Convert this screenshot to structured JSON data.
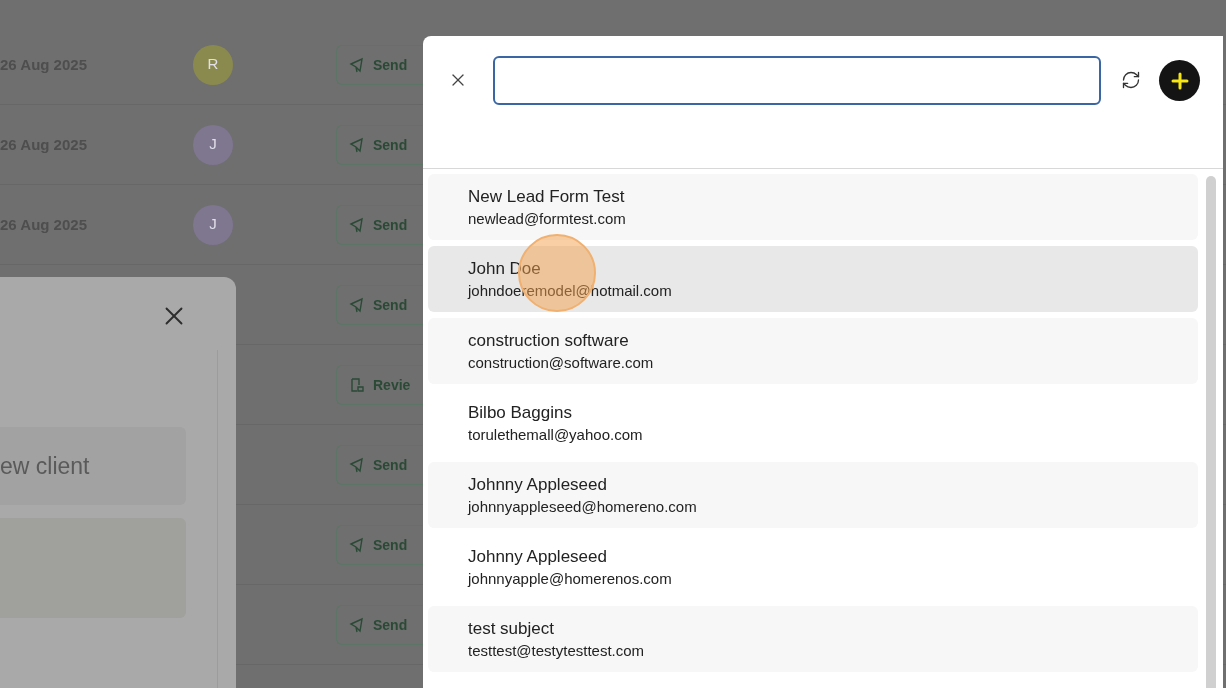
{
  "background_rows": [
    {
      "date": "26 Aug 2025",
      "avatar": {
        "letter": "R",
        "color": "#8b8a4e"
      },
      "action": {
        "kind": "send",
        "label": "Send"
      }
    },
    {
      "date": "26 Aug 2025",
      "avatar": {
        "letter": "J",
        "color": "#7f7690"
      },
      "action": {
        "kind": "send",
        "label": "Send"
      }
    },
    {
      "date": "26 Aug 2025",
      "avatar": {
        "letter": "J",
        "color": "#7f7690"
      },
      "action": {
        "kind": "send",
        "label": "Send"
      }
    },
    {
      "action": {
        "kind": "send",
        "label": "Send"
      }
    },
    {
      "action": {
        "kind": "review",
        "label": "Revie"
      }
    },
    {
      "action": {
        "kind": "send",
        "label": "Send"
      }
    },
    {
      "action": {
        "kind": "send",
        "label": "Send"
      }
    },
    {
      "action": {
        "kind": "send",
        "label": "Send"
      }
    }
  ],
  "modal": {
    "field_text": "ew client"
  },
  "picker": {
    "contacts": [
      {
        "name": "New Lead Form Test",
        "email": "newlead@formtest.com",
        "selected": false
      },
      {
        "name": "John Doe",
        "email": "johndoeremodel@hotmail.com",
        "selected": true
      },
      {
        "name": "construction software",
        "email": "construction@software.com",
        "selected": false
      },
      {
        "name": "Bilbo Baggins",
        "email": "torulethemall@yahoo.com",
        "selected": false
      },
      {
        "name": "Johnny Appleseed",
        "email": "johnnyappleseed@homereno.com",
        "selected": false
      },
      {
        "name": "Johnny Appleseed",
        "email": "johnnyapple@homerenos.com",
        "selected": false
      },
      {
        "name": "test subject",
        "email": "testtest@testytesttest.com",
        "selected": false
      }
    ]
  }
}
